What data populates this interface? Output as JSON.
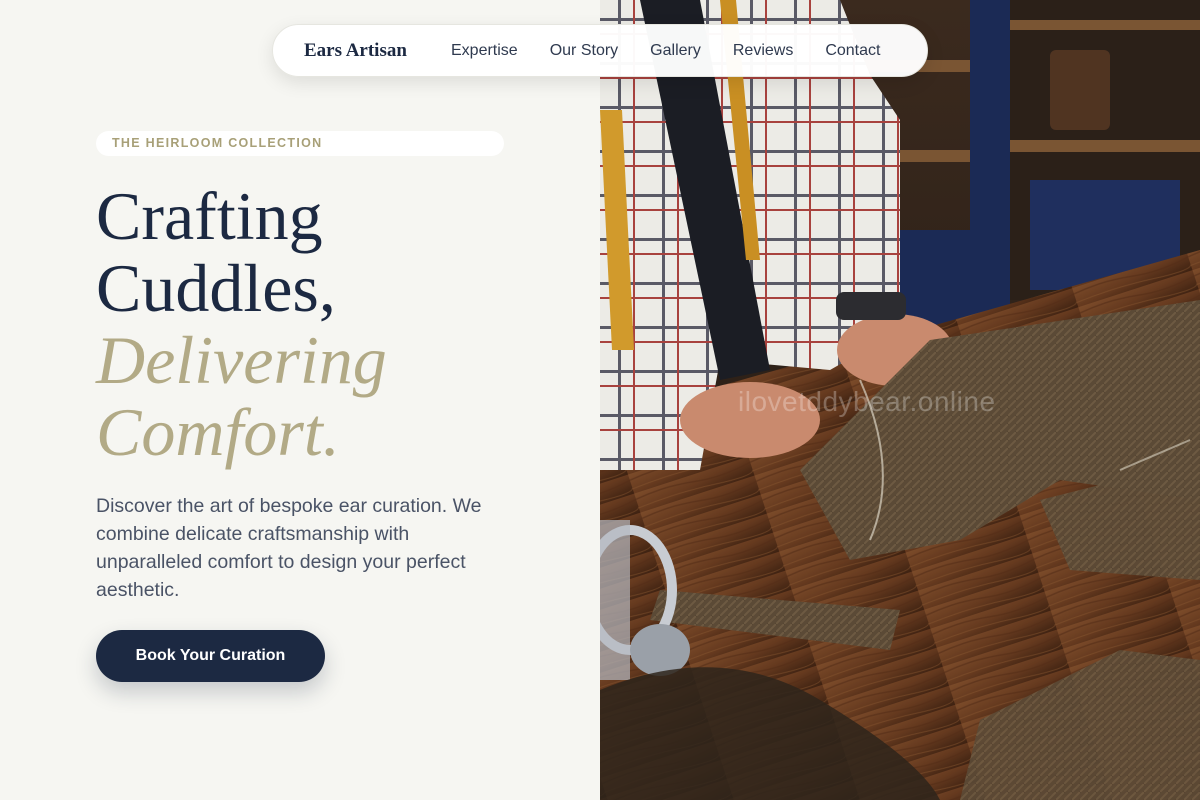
{
  "nav": {
    "brand": "Ears Artisan",
    "links": [
      "Expertise",
      "Our Story",
      "Gallery",
      "Reviews",
      "Contact"
    ]
  },
  "hero": {
    "eyebrow": "THE HEIRLOOM COLLECTION",
    "headline_line1": "Crafting",
    "headline_line2": "Cuddles,",
    "headline_line3": "Delivering",
    "headline_line4": "Comfort.",
    "description": "Discover the art of bespoke ear curation. We combine delicate craftsmanship with unparalleled comfort to design your perfect aesthetic.",
    "cta_label": "Book Your Curation"
  },
  "image": {
    "watermark": "ilovetddybear.online"
  },
  "colors": {
    "navy": "#1c2942",
    "gold": "#b2aa86",
    "background": "#f6f6f2"
  }
}
